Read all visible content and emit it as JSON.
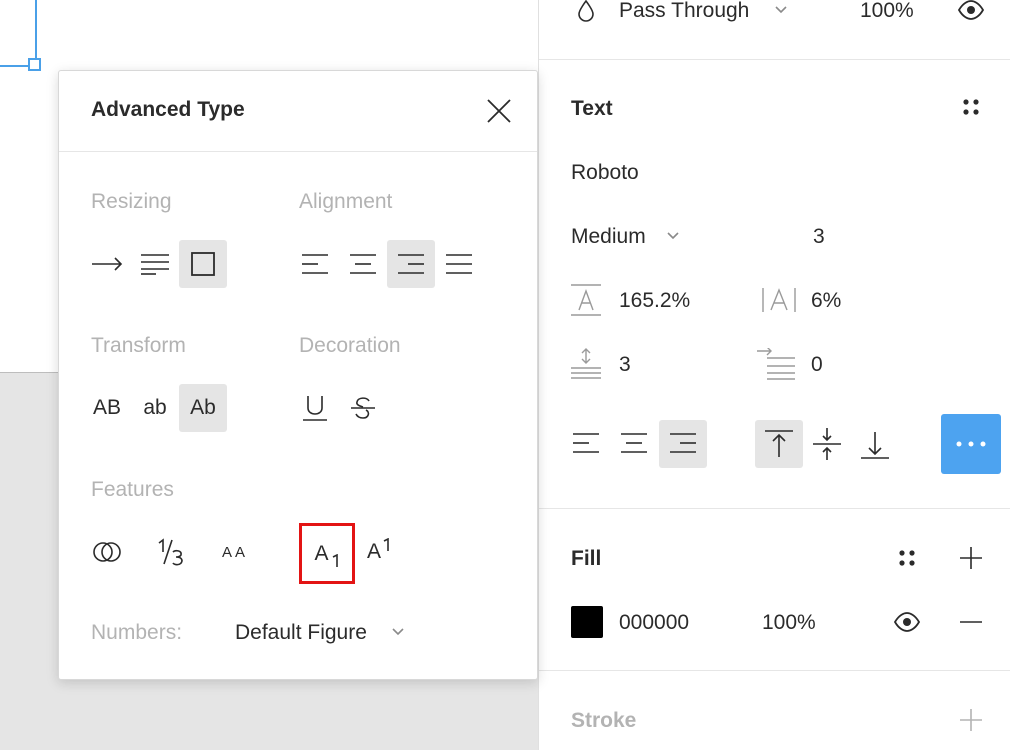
{
  "layer": {
    "blend_mode": "Pass Through",
    "opacity": "100%"
  },
  "text_section": {
    "title": "Text",
    "font_family": "Roboto",
    "font_weight": "Medium",
    "font_size": "3",
    "line_height": "165.2%",
    "letter_spacing": "6%",
    "paragraph_spacing": "3",
    "paragraph_indent": "0"
  },
  "fill_section": {
    "title": "Fill",
    "hex": "000000",
    "opacity": "100%",
    "color": "#000000"
  },
  "stroke_section": {
    "title": "Stroke"
  },
  "advanced_type": {
    "title": "Advanced Type",
    "resizing_label": "Resizing",
    "alignment_label": "Alignment",
    "transform_label": "Transform",
    "decoration_label": "Decoration",
    "features_label": "Features",
    "transform_options": [
      "AB",
      "ab",
      "Ab"
    ],
    "features": {
      "small_caps": "AA",
      "subscript": "A",
      "superscript": "A"
    },
    "numbers_label": "Numbers:",
    "numbers_value": "Default Figure"
  },
  "colors": {
    "accent": "#4da3f0",
    "selection": "#4aa0e8",
    "highlight": "#e31414"
  }
}
